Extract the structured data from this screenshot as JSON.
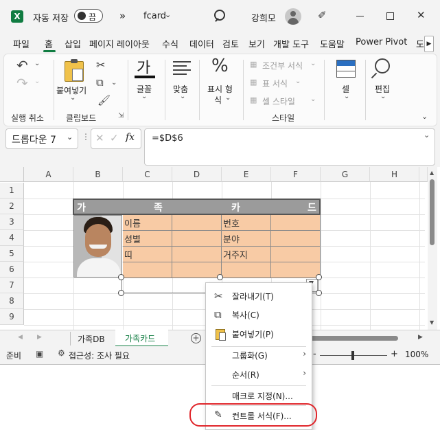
{
  "title_bar": {
    "autosave_label": "자동 저장",
    "toggle_state": "끔",
    "overflow": "»",
    "filename": "fcard",
    "user_name": "강희모"
  },
  "ribbon_tabs": [
    "파일",
    "홈",
    "삽입",
    "페이지 레이아웃",
    "수식",
    "데이터",
    "검토",
    "보기",
    "개발 도구",
    "도움말",
    "Power Pivot",
    "도"
  ],
  "ribbon": {
    "undo_group": "실행 취소",
    "paste": "붙여넣기",
    "clipboard_group": "클립보드",
    "font": "글꼴",
    "font_glyph": "가",
    "align": "맞춤",
    "number_line1": "표시 형",
    "number_line2": "식",
    "conditional": "조건부 서식",
    "table_format": "표 서식",
    "cell_style": "셀 스타일",
    "styles_group": "스타일",
    "cells": "셀",
    "editing": "편집"
  },
  "formula_bar": {
    "name_box": "드롭다운 7",
    "fx": "fx",
    "formula": "=$D$6"
  },
  "columns": [
    "A",
    "B",
    "C",
    "D",
    "E",
    "F",
    "G",
    "H"
  ],
  "rows": [
    "1",
    "2",
    "3",
    "4",
    "5",
    "6",
    "7",
    "8",
    "9"
  ],
  "card": {
    "title_chars": [
      "가",
      "족",
      "카",
      "드"
    ],
    "labels_left": [
      "이름",
      "성별",
      "띠"
    ],
    "labels_right": [
      "번호",
      "분야",
      "거주지"
    ]
  },
  "sheet_tabs": [
    "가족DB",
    "가족카드"
  ],
  "status": {
    "ready": "준비",
    "accessibility": "접근성: 조사 필요",
    "zoom": "100%",
    "minus": "-",
    "plus": "+"
  },
  "context_menu": [
    {
      "label": "잘라내기(T)",
      "icon": "scissors-icon"
    },
    {
      "label": "복사(C)",
      "icon": "copy-icon"
    },
    {
      "label": "붙여넣기(P)",
      "icon": "paste-icon"
    },
    {
      "label": "그룹화(G)",
      "submenu": true
    },
    {
      "label": "순서(R)",
      "submenu": true
    },
    {
      "label": "매크로 지정(N)..."
    },
    {
      "label": "컨트롤 서식(F)...",
      "icon": "format-control-icon"
    }
  ],
  "colors": {
    "excel_green": "#107c41",
    "card_header": "#9b9b9b",
    "card_fill": "#f8cba5",
    "annotation_red": "#e0262b"
  }
}
